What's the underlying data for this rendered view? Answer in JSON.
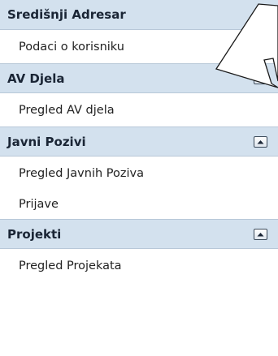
{
  "sections": [
    {
      "title": "Središnji Adresar",
      "collapsible": false,
      "items": [
        "Podaci o korisniku"
      ]
    },
    {
      "title": "AV Djela",
      "collapsible": true,
      "collapse_icon": "chevron-up-icon",
      "items": [
        "Pregled AV djela"
      ]
    },
    {
      "title": "Javni Pozivi",
      "collapsible": true,
      "collapse_icon": "chevron-up-icon",
      "items": [
        "Pregled Javnih Poziva",
        "Prijave"
      ]
    },
    {
      "title": "Projekti",
      "collapsible": true,
      "collapse_icon": "chevron-up-icon",
      "items": [
        "Pregled Projekata"
      ]
    }
  ],
  "annotation": {
    "type": "arrow-pointer",
    "points_to": "Podaci o korisniku"
  },
  "colors": {
    "header_bg": "#d3e1ee",
    "border": "#b8c8d8",
    "text": "#222222"
  }
}
